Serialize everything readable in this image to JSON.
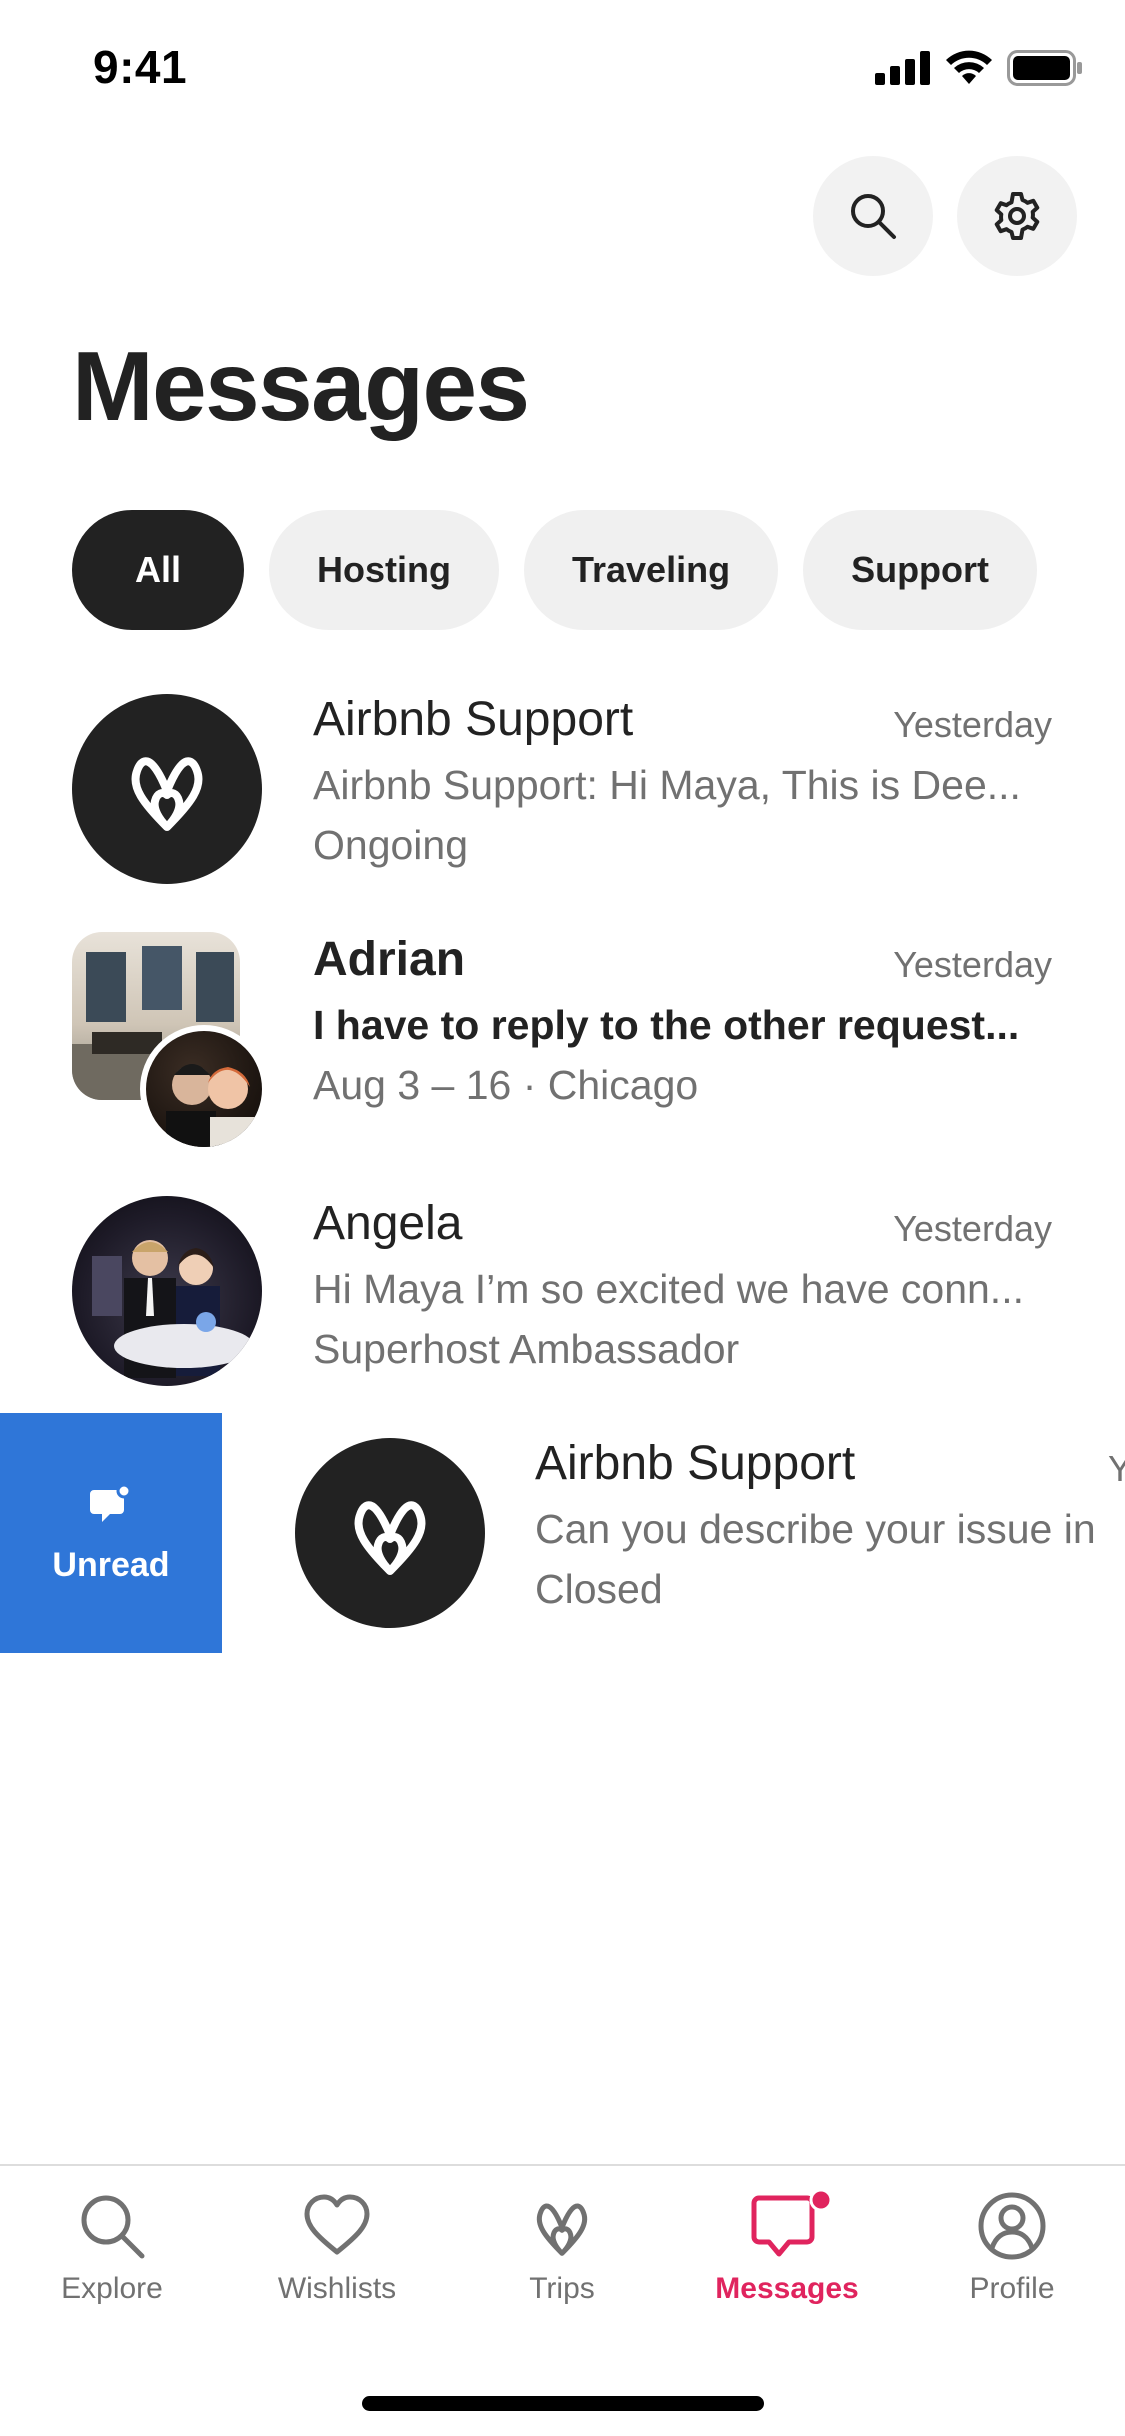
{
  "status_bar": {
    "time": "9:41"
  },
  "header": {
    "title": "Messages"
  },
  "filters": [
    {
      "label": "All",
      "active": true
    },
    {
      "label": "Hosting",
      "active": false
    },
    {
      "label": "Traveling",
      "active": false
    },
    {
      "label": "Support",
      "active": false
    }
  ],
  "messages": [
    {
      "name": "Airbnb Support",
      "time": "Yesterday",
      "preview": "Airbnb Support: Hi Maya,  This is Dee...",
      "subtext": "Ongoing",
      "unread": false
    },
    {
      "name": "Adrian",
      "time": "Yesterday",
      "preview": "I have to reply to the other request...",
      "subtext": "Aug 3 – 16 · Chicago",
      "unread": true
    },
    {
      "name": "Angela",
      "time": "Yesterday",
      "preview": "Hi Maya I’m so excited we have conn...",
      "subtext": "Superhost Ambassador",
      "unread": false
    },
    {
      "name": "Airbnb Support",
      "time": "Y",
      "preview": "Can you describe your issue in",
      "subtext": "Closed",
      "unread": false
    }
  ],
  "swipe_action": {
    "label": "Unread",
    "color": "#2f76d8"
  },
  "nav": [
    {
      "label": "Explore",
      "icon": "search-icon",
      "active": false
    },
    {
      "label": "Wishlists",
      "icon": "heart-icon",
      "active": false
    },
    {
      "label": "Trips",
      "icon": "airbnb-logo-icon",
      "active": false
    },
    {
      "label": "Messages",
      "icon": "message-icon",
      "active": true,
      "badge": true
    },
    {
      "label": "Profile",
      "icon": "profile-icon",
      "active": false
    }
  ],
  "colors": {
    "brand": "#e0245e",
    "text_primary": "#222222",
    "text_secondary": "#717171",
    "chip_bg": "#f0f0f0"
  }
}
